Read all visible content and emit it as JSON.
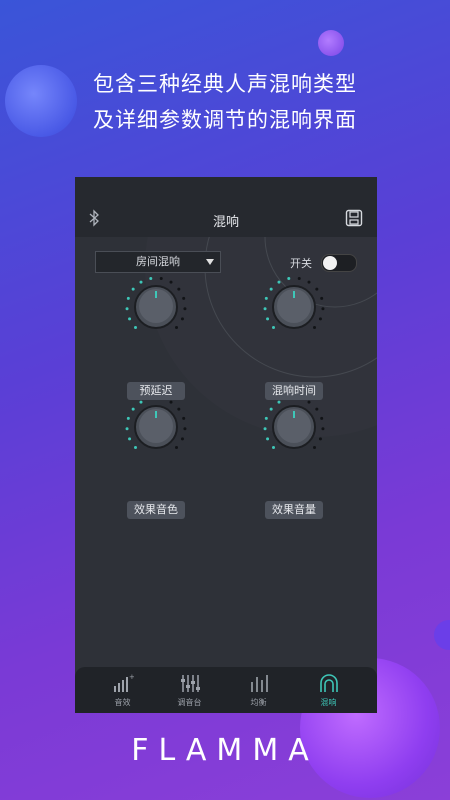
{
  "promo": {
    "line1": "包含三种经典人声混响类型",
    "line2": "及详细参数调节的混响界面",
    "brand": "FLAMMA"
  },
  "app": {
    "title": "混响",
    "preset": "房间混响",
    "switch_label": "开关",
    "switch_on": false,
    "knobs": [
      {
        "label": "预延迟"
      },
      {
        "label": "混响时间"
      },
      {
        "label": "效果音色"
      },
      {
        "label": "效果音量"
      }
    ],
    "tabs": [
      {
        "label": "音效",
        "icon": "sound-effect-icon"
      },
      {
        "label": "调音台",
        "icon": "mixer-icon"
      },
      {
        "label": "均衡",
        "icon": "equalizer-icon"
      },
      {
        "label": "混响",
        "icon": "reverb-icon",
        "active": true
      }
    ]
  },
  "colors": {
    "accent": "#3ec7b8",
    "panel": "#2e3138",
    "background_start": "#3a55d8",
    "background_end": "#8b3fd8"
  }
}
